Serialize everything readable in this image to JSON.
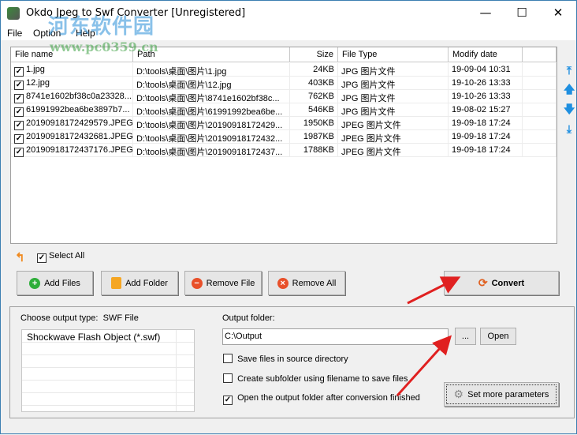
{
  "window": {
    "title": "Okdo Jpeg to Swf Converter [Unregistered]",
    "minimize": "—",
    "maximize": "☐",
    "close": "✕"
  },
  "watermark": {
    "name": "河东软件园",
    "url": "www.pc0359.cn"
  },
  "menu": [
    "File",
    "Option",
    "Help"
  ],
  "table": {
    "columns": [
      "File name",
      "Path",
      "Size",
      "File Type",
      "Modify date"
    ],
    "rows": [
      {
        "name": "1.jpg",
        "path": "D:\\tools\\桌面\\图片\\1.jpg",
        "size": "24KB",
        "type": "JPG 图片文件",
        "date": "19-09-04 10:31"
      },
      {
        "name": "12.jpg",
        "path": "D:\\tools\\桌面\\图片\\12.jpg",
        "size": "403KB",
        "type": "JPG 图片文件",
        "date": "19-10-26 13:33"
      },
      {
        "name": "8741e1602bf38c0a23328...",
        "path": "D:\\tools\\桌面\\图片\\8741e1602bf38c...",
        "size": "762KB",
        "type": "JPG 图片文件",
        "date": "19-10-26 13:33"
      },
      {
        "name": "61991992bea6be3897b7...",
        "path": "D:\\tools\\桌面\\图片\\61991992bea6be...",
        "size": "546KB",
        "type": "JPG 图片文件",
        "date": "19-08-02 15:27"
      },
      {
        "name": "20190918172429579.JPEG",
        "path": "D:\\tools\\桌面\\图片\\20190918172429...",
        "size": "1950KB",
        "type": "JPEG 图片文件",
        "date": "19-09-18 17:24"
      },
      {
        "name": "20190918172432681.JPEG",
        "path": "D:\\tools\\桌面\\图片\\20190918172432...",
        "size": "1987KB",
        "type": "JPEG 图片文件",
        "date": "19-09-18 17:24"
      },
      {
        "name": "20190918172437176.JPEG",
        "path": "D:\\tools\\桌面\\图片\\20190918172437...",
        "size": "1788KB",
        "type": "JPEG 图片文件",
        "date": "19-09-18 17:24"
      }
    ]
  },
  "select_all": "Select All",
  "buttons": {
    "add_files": "Add Files",
    "add_folder": "Add Folder",
    "remove_file": "Remove File",
    "remove_all": "Remove All",
    "convert": "Convert",
    "browse": "...",
    "open": "Open",
    "set_params": "Set more parameters"
  },
  "output": {
    "type_label": "Choose output type:",
    "type_value": "SWF File",
    "types": [
      "Shockwave Flash Object (*.swf)"
    ],
    "folder_label": "Output folder:",
    "folder_value": "C:\\Output",
    "options": [
      {
        "label": "Save files in source directory",
        "checked": false
      },
      {
        "label": "Create subfolder using filename to save files",
        "checked": false
      },
      {
        "label": "Open the output folder after conversion finished",
        "checked": true
      }
    ]
  },
  "colors": {
    "accent": "#1e8fe0",
    "arrow": "#e02020"
  }
}
